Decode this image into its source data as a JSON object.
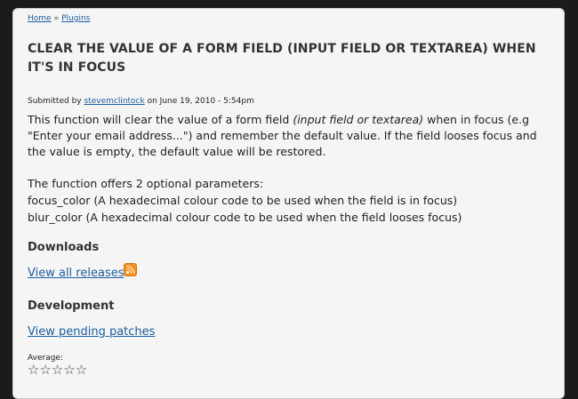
{
  "breadcrumb": {
    "home": "Home",
    "separator": "»",
    "plugins": "Plugins"
  },
  "title": "CLEAR THE VALUE OF A FORM FIELD (INPUT FIELD OR TEXTAREA) WHEN IT'S IN FOCUS",
  "submitted": {
    "prefix": "Submitted by",
    "author": "stevemclintock",
    "suffix": "on June 19, 2010 - 5:54pm"
  },
  "description": {
    "part1": "This function will clear the value of a form field ",
    "italic": "(input field or textarea)",
    "part2": " when in focus (e.g \"Enter your email address...\") and remember the default value. If the field looses focus and the value is empty, the default value will be restored."
  },
  "params": {
    "intro": "The function offers 2 optional parameters:",
    "focus": "focus_color (A hexadecimal colour code to be used when the field is in focus)",
    "blur": "blur_color (A hexadecimal colour code to be used when the field looses focus)"
  },
  "downloads": {
    "heading": "Downloads",
    "link": "View all releases",
    "icon": "rss-icon"
  },
  "development": {
    "heading": "Development",
    "link": "View pending patches"
  },
  "rating": {
    "label": "Average:",
    "stars": "☆☆☆☆☆"
  },
  "colors": {
    "link": "#1d5fa0",
    "rss": "#f7921e",
    "background": "#1b1b1b",
    "panel": "#f5f5f5"
  }
}
